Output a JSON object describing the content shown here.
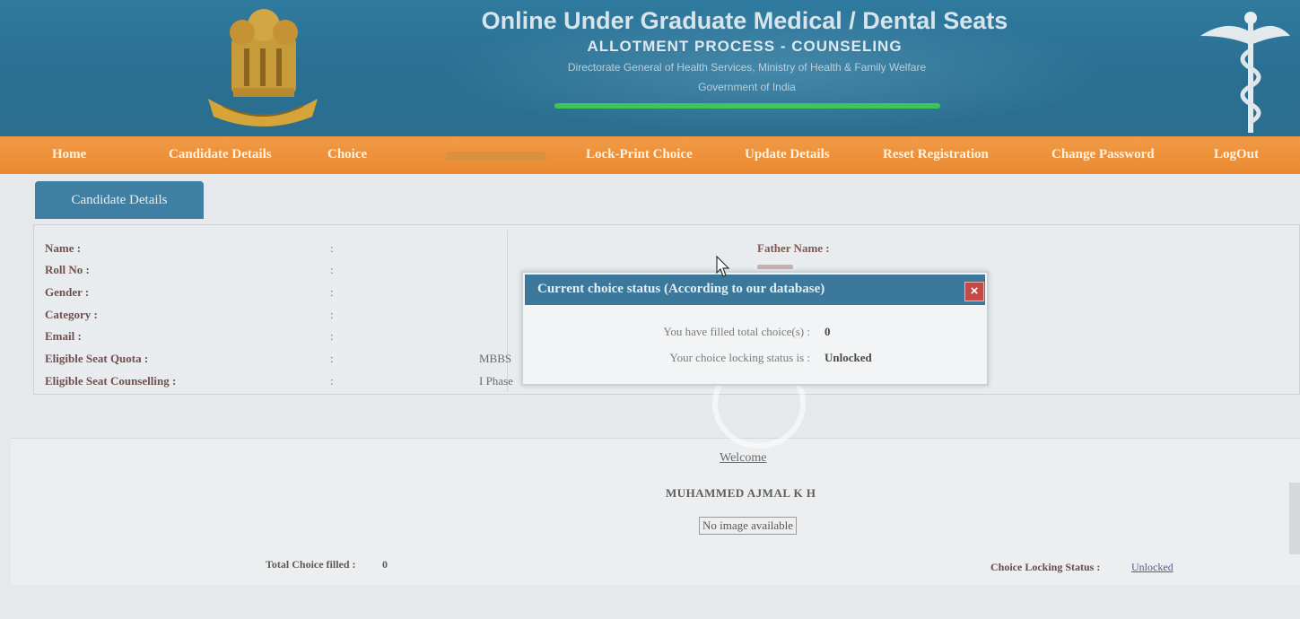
{
  "header": {
    "title": "Online Under Graduate Medical / Dental Seats",
    "subtitle": "ALLOTMENT PROCESS - COUNSELING",
    "department": "Directorate General of Health Services, Ministry of Health & Family Welfare",
    "government": "Government of India",
    "emblem_icon": "national-emblem-icon",
    "caduceus_icon": "caduceus-icon"
  },
  "nav": {
    "items": [
      {
        "label": "Home"
      },
      {
        "label": "Candidate Details"
      },
      {
        "label": "Choice"
      },
      {
        "label": "Lock-Print Choice"
      },
      {
        "label": "Update Details"
      },
      {
        "label": "Reset Registration"
      },
      {
        "label": "Change Password"
      },
      {
        "label": "LogOut"
      }
    ]
  },
  "candidate_tab": {
    "label": "Candidate Details"
  },
  "details": {
    "rows": [
      {
        "label": "Name :",
        "sep": ":",
        "value": ""
      },
      {
        "label": "Roll No :",
        "sep": ":",
        "value": ""
      },
      {
        "label": "Gender :",
        "sep": ":",
        "value": ""
      },
      {
        "label": "Category :",
        "sep": ":",
        "value": ""
      },
      {
        "label": "Email :",
        "sep": ":",
        "value": ""
      },
      {
        "label": "Eligible Seat Quota :",
        "sep": ":",
        "value": "MBBS"
      },
      {
        "label": "Eligible Seat Counselling :",
        "sep": ":",
        "value": "I Phase"
      }
    ],
    "father_label": "Father Name :"
  },
  "modal": {
    "title": "Current choice status (According to our database)",
    "close_label": "×",
    "filled_label": "You have filled total choice(s) :",
    "filled_value": "0",
    "locking_label": "Your choice locking status is :",
    "locking_value": "Unlocked"
  },
  "welcome": {
    "label": "Welcome",
    "candidate_name": "MUHAMMED AJMAL K H",
    "image_placeholder": "No image available",
    "total_label": "Total Choice filled :",
    "total_value": "0",
    "lock_status_label": "Choice Locking Status :",
    "lock_status_value": "Unlocked"
  },
  "colors": {
    "banner": "#2a6f92",
    "nav": "#e98a31",
    "modal_header": "#3b789c",
    "close_button": "#c44a47"
  }
}
